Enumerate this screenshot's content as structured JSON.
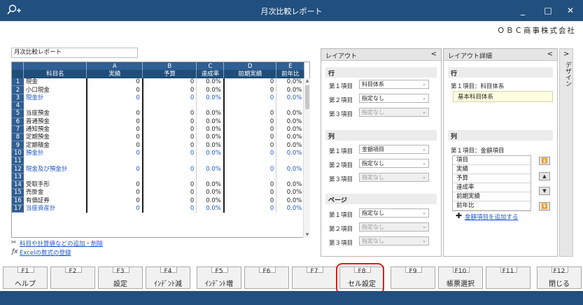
{
  "window": {
    "title": "月次比較レポート",
    "minimize": "_",
    "maximize": "□",
    "close": "✕"
  },
  "company": "ＯＢＣ商事株式会社",
  "report_name": "月次比較レポート",
  "sheet": {
    "col_letters": [
      "A",
      "B",
      "C",
      "D",
      "E"
    ],
    "headers": [
      "科目名",
      "実績",
      "予算",
      "達成率",
      "前期実績",
      "前年比"
    ],
    "rows": [
      {
        "n": "1",
        "name": "現金",
        "vals": [
          "0",
          "0",
          "0.0%",
          "0",
          "0.0%"
        ]
      },
      {
        "n": "2",
        "name": "小口現金",
        "vals": [
          "0",
          "0",
          "0.0%",
          "0",
          "0.0%"
        ]
      },
      {
        "n": "3",
        "name": "現金計",
        "vals": [
          "0",
          "0",
          "0.0%",
          "0",
          "0.0%"
        ],
        "blue": true
      },
      {
        "n": "4",
        "name": "",
        "vals": [
          "",
          "",
          "",
          "",
          ""
        ]
      },
      {
        "n": "5",
        "name": "当座預金",
        "vals": [
          "0",
          "0",
          "0.0%",
          "0",
          "0.0%"
        ]
      },
      {
        "n": "6",
        "name": "普通預金",
        "vals": [
          "0",
          "0",
          "0.0%",
          "0",
          "0.0%"
        ]
      },
      {
        "n": "7",
        "name": "通知預金",
        "vals": [
          "0",
          "0",
          "0.0%",
          "0",
          "0.0%"
        ]
      },
      {
        "n": "8",
        "name": "定期預金",
        "vals": [
          "0",
          "0",
          "0.0%",
          "0",
          "0.0%"
        ]
      },
      {
        "n": "9",
        "name": "定期積金",
        "vals": [
          "0",
          "0",
          "0.0%",
          "0",
          "0.0%"
        ]
      },
      {
        "n": "10",
        "name": "預金計",
        "vals": [
          "0",
          "0",
          "0.0%",
          "0",
          "0.0%"
        ],
        "blue": true
      },
      {
        "n": "11",
        "name": "",
        "vals": [
          "",
          "",
          "",
          "",
          ""
        ]
      },
      {
        "n": "12",
        "name": "現金及び預金計",
        "vals": [
          "0",
          "0",
          "0.0%",
          "0",
          "0.0%"
        ],
        "blue": true
      },
      {
        "n": "13",
        "name": "",
        "vals": [
          "",
          "",
          "",
          "",
          ""
        ]
      },
      {
        "n": "14",
        "name": "受取手形",
        "vals": [
          "0",
          "0",
          "0.0%",
          "0",
          "0.0%"
        ]
      },
      {
        "n": "15",
        "name": "売掛金",
        "vals": [
          "0",
          "0",
          "0.0%",
          "0",
          "0.0%"
        ]
      },
      {
        "n": "16",
        "name": "有価証券",
        "vals": [
          "0",
          "0",
          "0.0%",
          "0",
          "0.0%"
        ]
      },
      {
        "n": "17",
        "name": "当座資産計",
        "vals": [
          "0",
          "0",
          "0.0%",
          "0",
          "0.0%"
        ],
        "blue": true
      }
    ]
  },
  "links": {
    "add_remove": "科目や計算値などの追加・削除",
    "excel_formula": "Excelの数式の登録",
    "add_amount": "金額項目を追加する"
  },
  "layout": {
    "title": "レイアウト",
    "chev": "<",
    "row_section": "行",
    "col_section": "列",
    "page_section": "ページ",
    "items": {
      "i1": "第１項目",
      "i2": "第２項目",
      "i3": "第３項目"
    },
    "row_values": [
      "科目体系",
      "指定なし",
      "指定なし"
    ],
    "col_values": [
      "金額項目",
      "指定なし",
      "指定なし"
    ],
    "page_values": [
      "指定なし",
      "指定なし",
      "指定なし"
    ]
  },
  "detail": {
    "title": "レイアウト詳細",
    "chev": "<",
    "row_section": "行",
    "row_label": "第１項目：科目体系",
    "row_value": "基本科目体系",
    "col_section": "列",
    "col_label": "第１項目：金額項目",
    "col_items": [
      "項目",
      "実績",
      "予算",
      "達成率",
      "前期実績",
      "前年比"
    ]
  },
  "side": {
    "chev": ">",
    "label": "デザイン"
  },
  "fkeys": [
    {
      "n": "F1",
      "t": "ヘルプ"
    },
    {
      "n": "F2",
      "t": ""
    },
    {
      "n": "F3",
      "t": "設定"
    },
    {
      "n": "F4",
      "t": "ｲﾝﾃﾞﾝﾄ減"
    },
    {
      "n": "F5",
      "t": "ｲﾝﾃﾞﾝﾄ増"
    },
    {
      "n": "F6",
      "t": ""
    },
    {
      "n": "F7",
      "t": ""
    },
    {
      "n": "F8",
      "t": "セル設定"
    },
    {
      "n": "F9",
      "t": ""
    },
    {
      "n": "F10",
      "t": "帳票選択"
    },
    {
      "n": "F11",
      "t": ""
    },
    {
      "n": "F12",
      "t": "閉じる"
    }
  ]
}
